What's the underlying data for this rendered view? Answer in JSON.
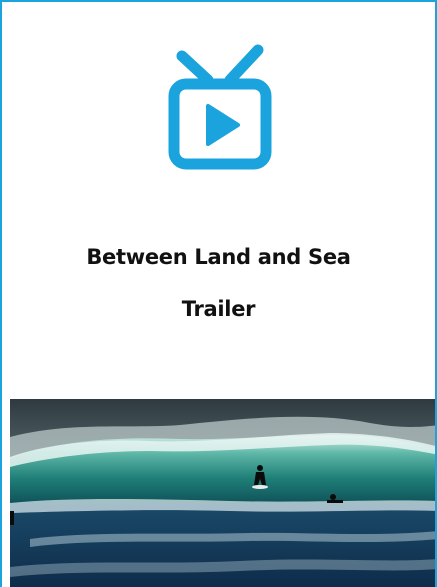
{
  "card": {
    "accent_color": "#1aa3dd",
    "icon": "tv-play-icon",
    "title_line1": "Between Land and Sea",
    "title_line2": "Trailer"
  },
  "media": {
    "thumbnail": "surf-wave-photo"
  }
}
